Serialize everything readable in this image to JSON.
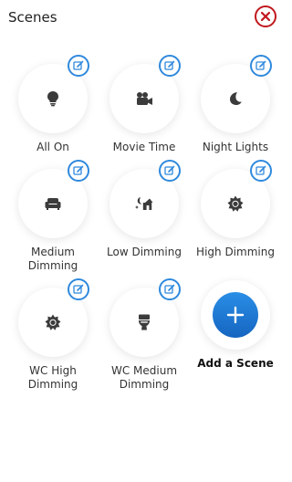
{
  "header": {
    "title": "Scenes",
    "close_icon": "close-circle-icon"
  },
  "colors": {
    "accent": "#2f89dd",
    "close": "#c0171d",
    "icon": "#3b3b3b"
  },
  "scenes": [
    {
      "label": "All On",
      "icon": "lightbulb-icon"
    },
    {
      "label": "Movie Time",
      "icon": "video-camera-icon"
    },
    {
      "label": "Night Lights",
      "icon": "moon-icon"
    },
    {
      "label": "Medium Dimming",
      "icon": "armchair-icon"
    },
    {
      "label": "Low Dimming",
      "icon": "night-home-icon"
    },
    {
      "label": "High Dimming",
      "icon": "sun-icon"
    },
    {
      "label": "WC High Dimming",
      "icon": "sun-icon"
    },
    {
      "label": "WC Medium Dimming",
      "icon": "toilet-icon"
    }
  ],
  "add_scene": {
    "label": "Add a Scene",
    "icon": "plus-icon"
  }
}
